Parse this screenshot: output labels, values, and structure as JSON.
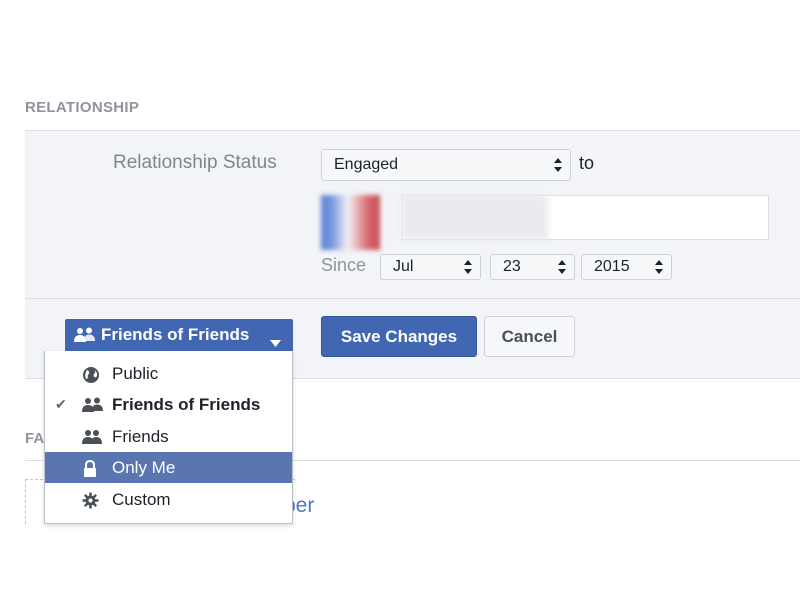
{
  "section": {
    "title": "RELATIONSHIP"
  },
  "relationship": {
    "label": "Relationship Status",
    "status_value": "Engaged",
    "to_text": "to",
    "since_label": "Since",
    "month": "Jul",
    "day": "23",
    "year": "2015"
  },
  "privacy": {
    "button_label": "Friends of Friends",
    "menu": [
      {
        "label": "Public",
        "icon": "globe-icon",
        "checked": false,
        "highlighted": false
      },
      {
        "label": "Friends of Friends",
        "icon": "friends-of-friends-icon",
        "checked": true,
        "highlighted": false
      },
      {
        "label": "Friends",
        "icon": "friends-icon",
        "checked": false,
        "highlighted": false
      },
      {
        "label": "Only Me",
        "icon": "lock-icon",
        "checked": false,
        "highlighted": true
      },
      {
        "label": "Custom",
        "icon": "gear-icon",
        "checked": false,
        "highlighted": false
      }
    ],
    "check_glyph": "✔"
  },
  "actions": {
    "save_label": "Save Changes",
    "cancel_label": "Cancel"
  },
  "background": {
    "partial_section_label": "FA",
    "partial_link_text": "ber"
  },
  "colors": {
    "brand_blue": "#4267b2",
    "menu_highlight": "#5a76b0",
    "panel_bg": "#f2f4f8"
  }
}
